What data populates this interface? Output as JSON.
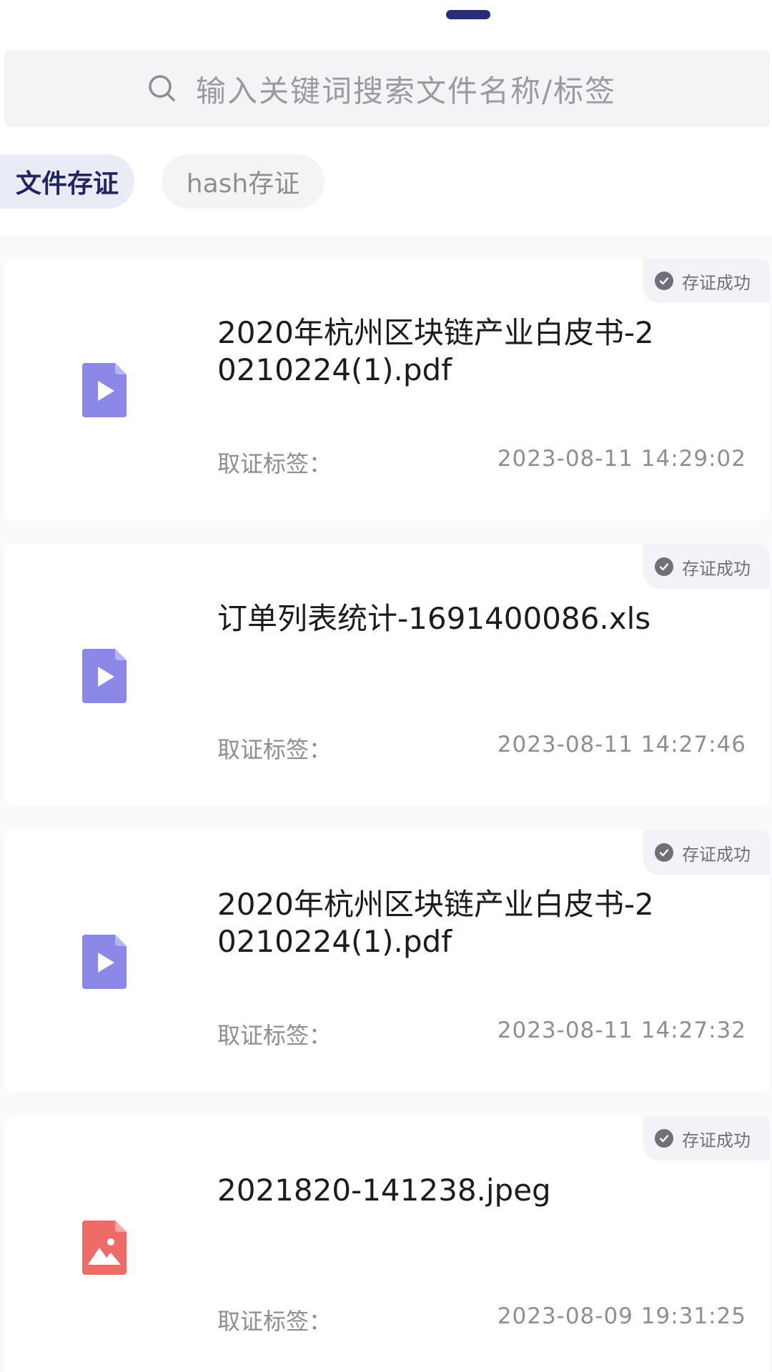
{
  "search": {
    "placeholder": "输入关键词搜索文件名称/标签"
  },
  "tabs": [
    {
      "label": "文件存证",
      "active": true
    },
    {
      "label": "hash存证",
      "active": false
    }
  ],
  "colors": {
    "accent": "#23265e",
    "file_icon_default": "#8b88e8",
    "file_icon_image": "#ee6b67"
  },
  "records": [
    {
      "title": "2020年杭州区块链产业白皮书-20210224(1).pdf",
      "status": "存证成功",
      "tag_label": "取证标签：",
      "timestamp": "2023-08-11 14:29:02",
      "icon": "play-file-icon"
    },
    {
      "title": "订单列表统计-1691400086.xls",
      "status": "存证成功",
      "tag_label": "取证标签：",
      "timestamp": "2023-08-11 14:27:46",
      "icon": "play-file-icon"
    },
    {
      "title": "2020年杭州区块链产业白皮书-20210224(1).pdf",
      "status": "存证成功",
      "tag_label": "取证标签：",
      "timestamp": "2023-08-11 14:27:32",
      "icon": "play-file-icon"
    },
    {
      "title": "2021820-141238.jpeg",
      "status": "存证成功",
      "tag_label": "取证标签：",
      "timestamp": "2023-08-09 19:31:25",
      "icon": "image-file-icon"
    }
  ]
}
